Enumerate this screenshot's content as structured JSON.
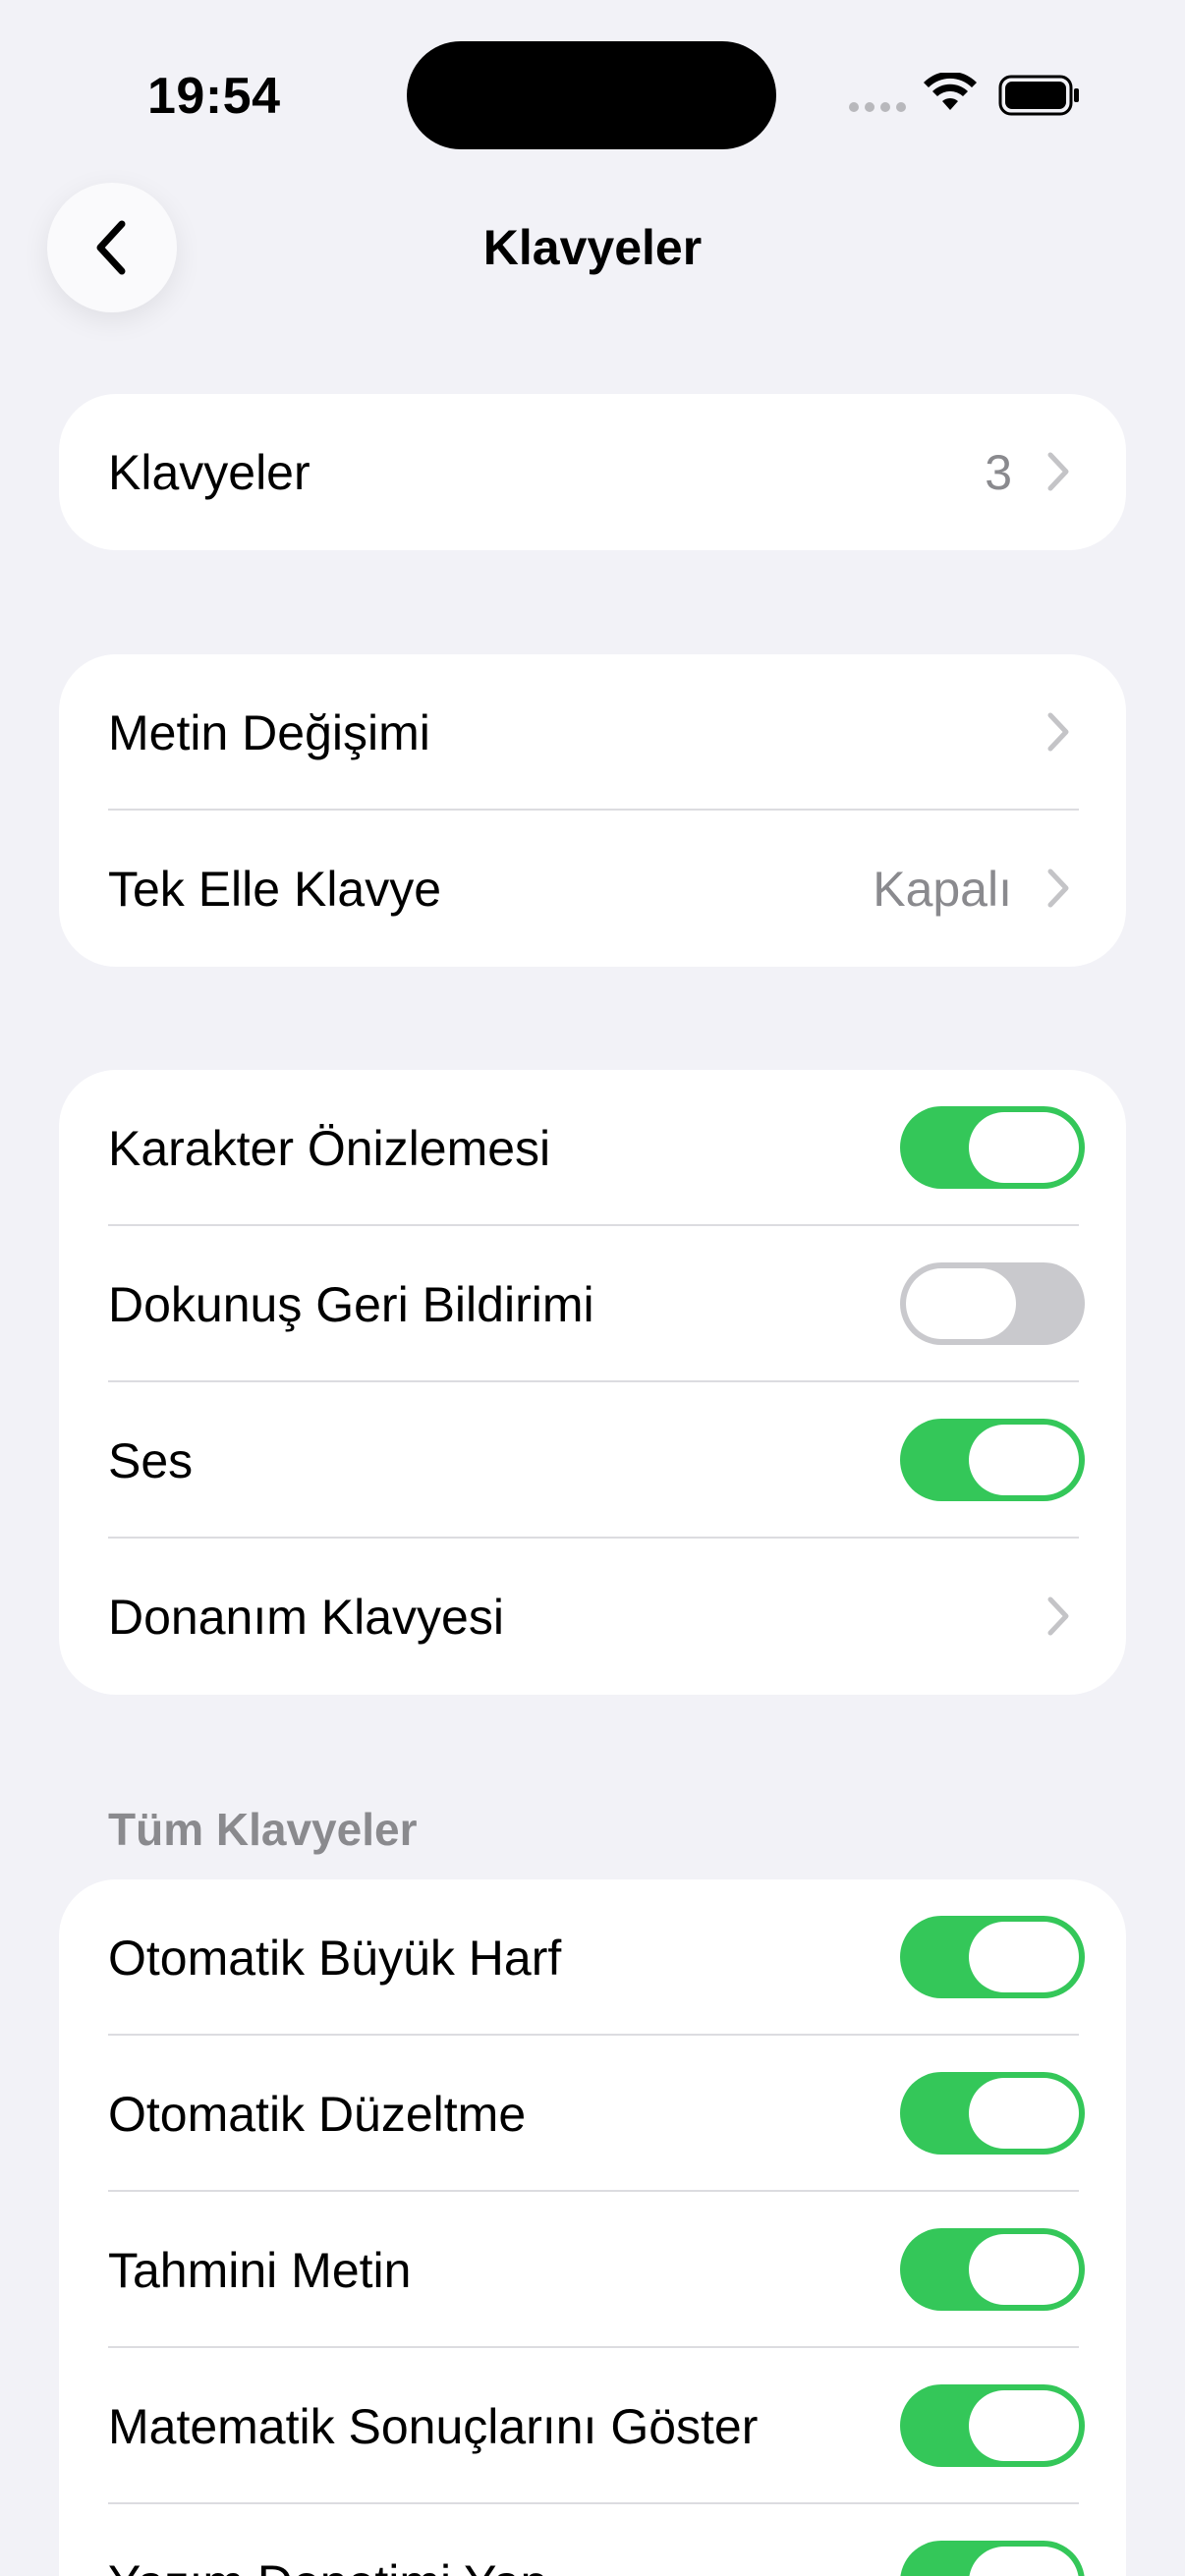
{
  "status_bar": {
    "time": "19:54"
  },
  "nav": {
    "title": "Klavyeler",
    "back_icon": "chevron-left-icon"
  },
  "group1": {
    "rows": [
      {
        "label": "Klavyeler",
        "value": "3"
      }
    ]
  },
  "group2": {
    "rows": [
      {
        "label": "Metin Değişimi",
        "value": ""
      },
      {
        "label": "Tek Elle Klavye",
        "value": "Kapalı"
      }
    ]
  },
  "group3": {
    "rows": [
      {
        "label": "Karakter Önizlemesi",
        "toggle": true
      },
      {
        "label": "Dokunuş Geri Bildirimi",
        "toggle": false
      },
      {
        "label": "Ses",
        "toggle": true
      },
      {
        "label": "Donanım Klavyesi"
      }
    ]
  },
  "group4": {
    "header": "Tüm Klavyeler",
    "rows": [
      {
        "label": "Otomatik Büyük Harf",
        "toggle": true
      },
      {
        "label": "Otomatik Düzeltme",
        "toggle": true
      },
      {
        "label": "Tahmini Metin",
        "toggle": true
      },
      {
        "label": "Matematik Sonuçlarını Göster",
        "toggle": true
      },
      {
        "label": "Yazım Denetimi Yap",
        "toggle": true
      }
    ]
  },
  "colors": {
    "toggle_on": "#34c759",
    "toggle_off": "#c9c9cd",
    "background": "#f2f2f7",
    "secondary_text": "#8a8a8e"
  }
}
